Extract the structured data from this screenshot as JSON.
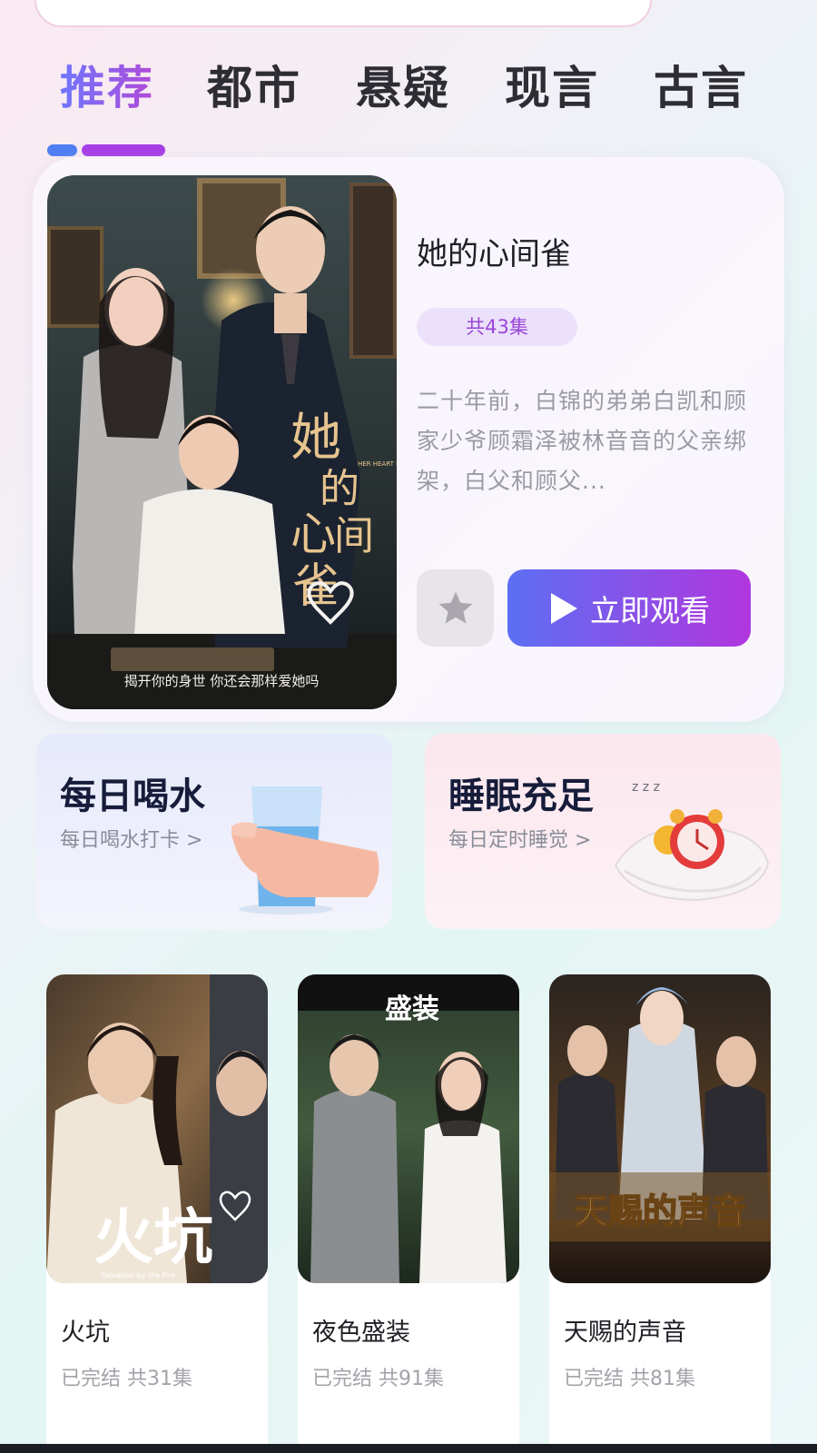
{
  "tabs": [
    {
      "label": "推荐",
      "active": true
    },
    {
      "label": "都市",
      "active": false
    },
    {
      "label": "悬疑",
      "active": false
    },
    {
      "label": "现言",
      "active": false
    },
    {
      "label": "古言",
      "active": false
    }
  ],
  "feature": {
    "title": "她的心间雀",
    "episodes": "共43集",
    "synopsis": "二十年前，白锦的弟弟白凯和顾家少爷顾霜泽被林音音的父亲绑架，白父和顾父...",
    "poster_title": "她的心间雀",
    "poster_subtitle_en": "HER HEART BIRD",
    "poster_tagline": "揭开你的身世  你还会那样爱她吗",
    "watch_label": "立即观看",
    "favorite_icon": "star-icon",
    "play_icon": "play-icon"
  },
  "widgets": [
    {
      "title": "每日喝水",
      "subtitle": "每日喝水打卡 >"
    },
    {
      "title": "睡眠充足",
      "subtitle": "每日定时睡觉 >"
    }
  ],
  "dramas": [
    {
      "name": "火坑",
      "meta": "已完结 共31集",
      "poster_text": "火坑",
      "poster_sub": "Salvation by the Fire"
    },
    {
      "name": "夜色盛装",
      "meta": "已完结 共91集",
      "poster_text": "盛装"
    },
    {
      "name": "天赐的声音",
      "meta": "已完结 共81集",
      "poster_text": "天赐的声音"
    }
  ],
  "colors": {
    "accent_start": "#5c6ff3",
    "accent_end": "#b236de",
    "pill_bg": "#ece1fb",
    "pill_text": "#9a44d6"
  }
}
